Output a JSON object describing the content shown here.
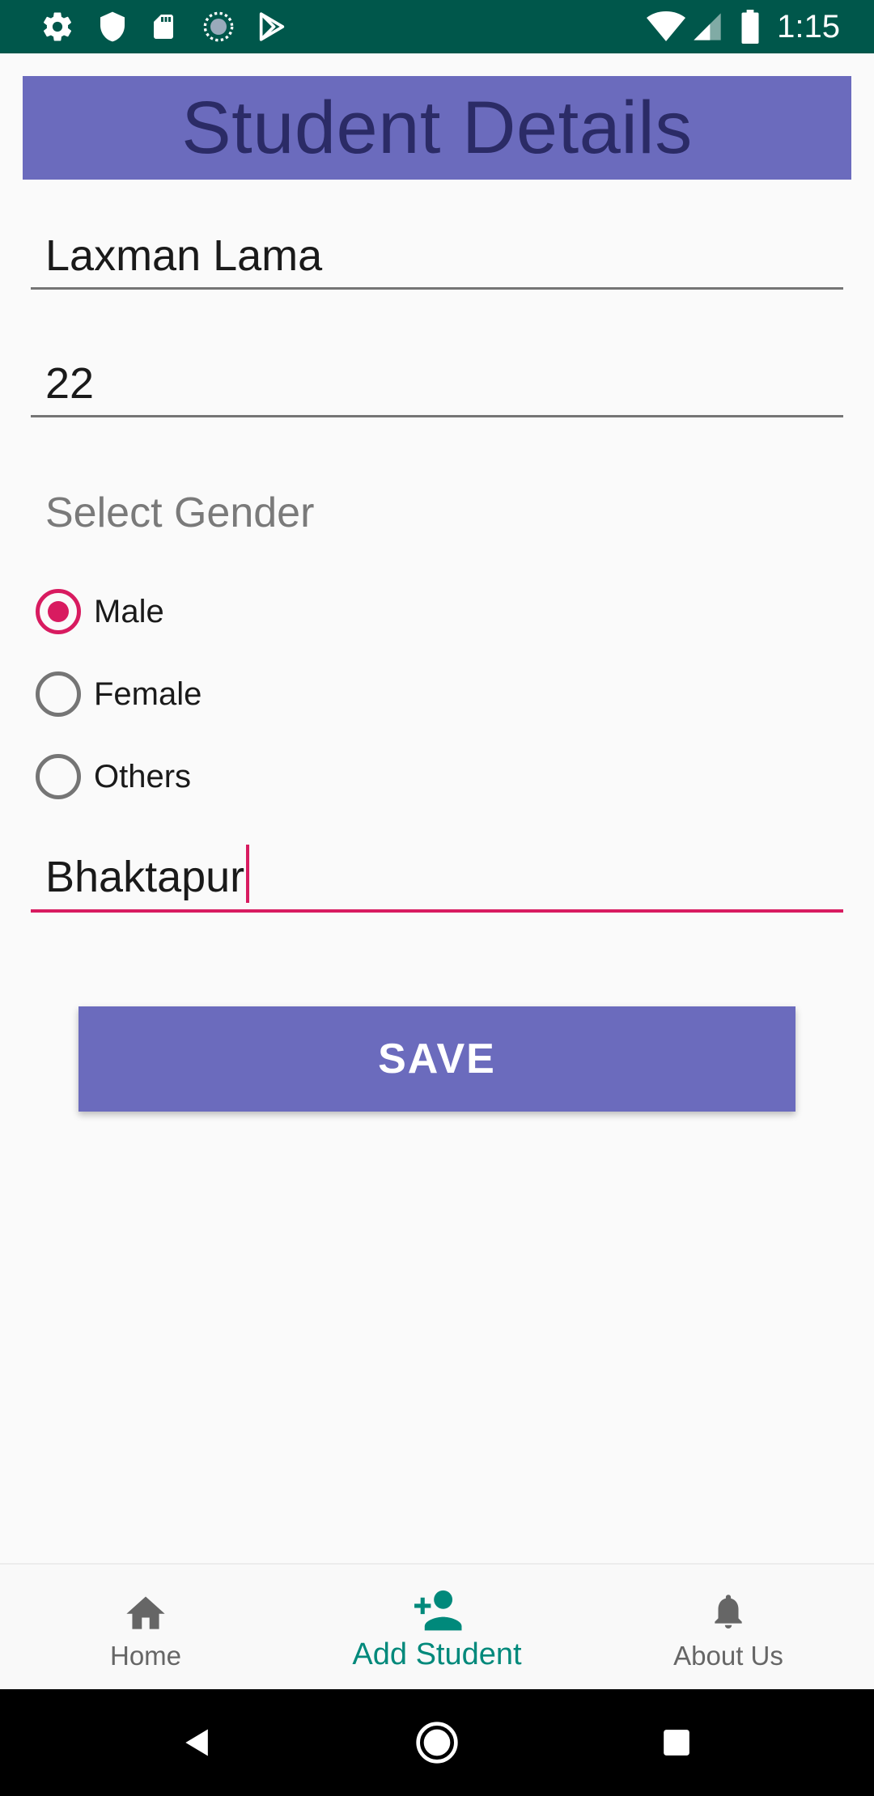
{
  "status_bar": {
    "time": "1:15",
    "icons": [
      "settings-icon",
      "shield-icon",
      "sd-card-icon",
      "sync-icon",
      "play-store-icon",
      "wifi-icon",
      "signal-icon",
      "battery-icon"
    ]
  },
  "header": {
    "title": "Student Details"
  },
  "form": {
    "name_value": "Laxman Lama",
    "age_value": "22",
    "gender_label": "Select Gender",
    "gender_options": [
      {
        "label": "Male",
        "checked": true
      },
      {
        "label": "Female",
        "checked": false
      },
      {
        "label": "Others",
        "checked": false
      }
    ],
    "address_value": "Bhaktapur",
    "save_label": "SAVE"
  },
  "bottom_nav": {
    "items": [
      {
        "label": "Home",
        "icon": "home-icon",
        "active": false
      },
      {
        "label": "Add Student",
        "icon": "add-person-icon",
        "active": true
      },
      {
        "label": "About Us",
        "icon": "bell-icon",
        "active": false
      }
    ]
  },
  "system_nav": {
    "buttons": [
      "back-icon",
      "home-circle-icon",
      "recents-icon"
    ]
  },
  "colors": {
    "status_bar": "#00574b",
    "primary": "#6b6bbd",
    "accent": "#d81b60",
    "nav_active": "#00897b"
  }
}
